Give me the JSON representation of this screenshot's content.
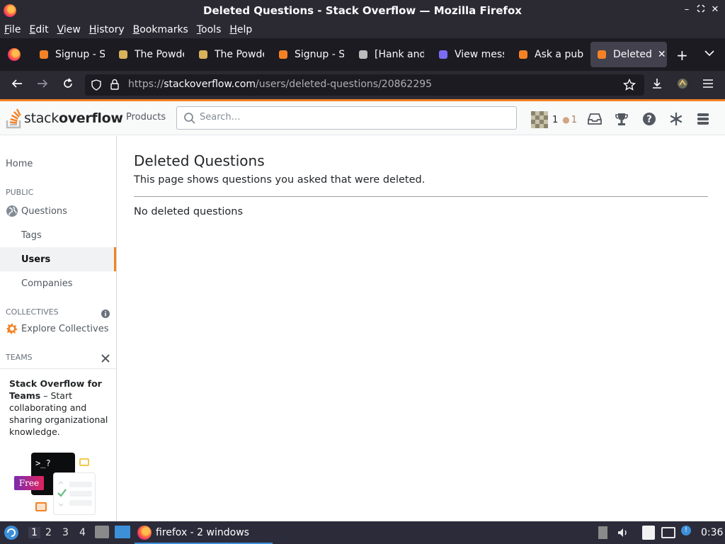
{
  "window": {
    "title": "Deleted Questions - Stack Overflow — Mozilla Firefox"
  },
  "menu": {
    "items": [
      {
        "label": "File",
        "u": "F",
        "rest": "ile"
      },
      {
        "label": "Edit",
        "u": "E",
        "rest": "dit"
      },
      {
        "label": "View",
        "u": "V",
        "rest": "iew"
      },
      {
        "label": "History",
        "u": "H",
        "rest": "istory"
      },
      {
        "label": "Bookmarks",
        "u": "B",
        "rest": "ookmarks"
      },
      {
        "label": "Tools",
        "u": "T",
        "rest": "ools"
      },
      {
        "label": "Help",
        "u": "H",
        "rest": "elp"
      }
    ]
  },
  "tabs": [
    {
      "label": "Signup - S",
      "icon": "stackoverflow-icon"
    },
    {
      "label": "The Powde",
      "icon": "film-icon"
    },
    {
      "label": "The Powde",
      "icon": "film-icon"
    },
    {
      "label": "Signup - S",
      "icon": "stackoverflow-icon"
    },
    {
      "label": "[Hank and",
      "icon": "q-icon"
    },
    {
      "label": "View mess",
      "icon": "at-icon"
    },
    {
      "label": "Ask a publ",
      "icon": "stackoverflow-icon"
    },
    {
      "label": "Deleted",
      "icon": "stackoverflow-icon",
      "active": true
    }
  ],
  "navbar": {
    "url_prefix": "https://",
    "url_domain": "stackoverflow.com",
    "url_path": "/users/deleted-questions/20862295"
  },
  "so_header": {
    "logo_light": "stack",
    "logo_bold": "overflow",
    "products": "Products",
    "search_placeholder": "Search…",
    "reputation": "1",
    "bronze_badges": "1"
  },
  "sidebar": {
    "home": "Home",
    "public_label": "PUBLIC",
    "questions": "Questions",
    "tags": "Tags",
    "users": "Users",
    "companies": "Companies",
    "collectives_label": "COLLECTIVES",
    "explore_collectives": "Explore Collectives",
    "teams_label": "TEAMS",
    "teams_bold": "Stack Overflow for Teams",
    "teams_rest": " – Start collaborating and sharing organizational knowledge.",
    "free_badge": "Free",
    "terminal_text": ">_?"
  },
  "main": {
    "title": "Deleted Questions",
    "subtitle": "This page shows questions you asked that were deleted.",
    "empty": "No deleted questions"
  },
  "taskbar": {
    "workspaces": [
      "1",
      "2",
      "3",
      "4"
    ],
    "task_label": "firefox - 2 windows",
    "clock": "0:36"
  },
  "colors": {
    "so_orange": "#f48225",
    "firefox_dark": "#2b2a33"
  }
}
